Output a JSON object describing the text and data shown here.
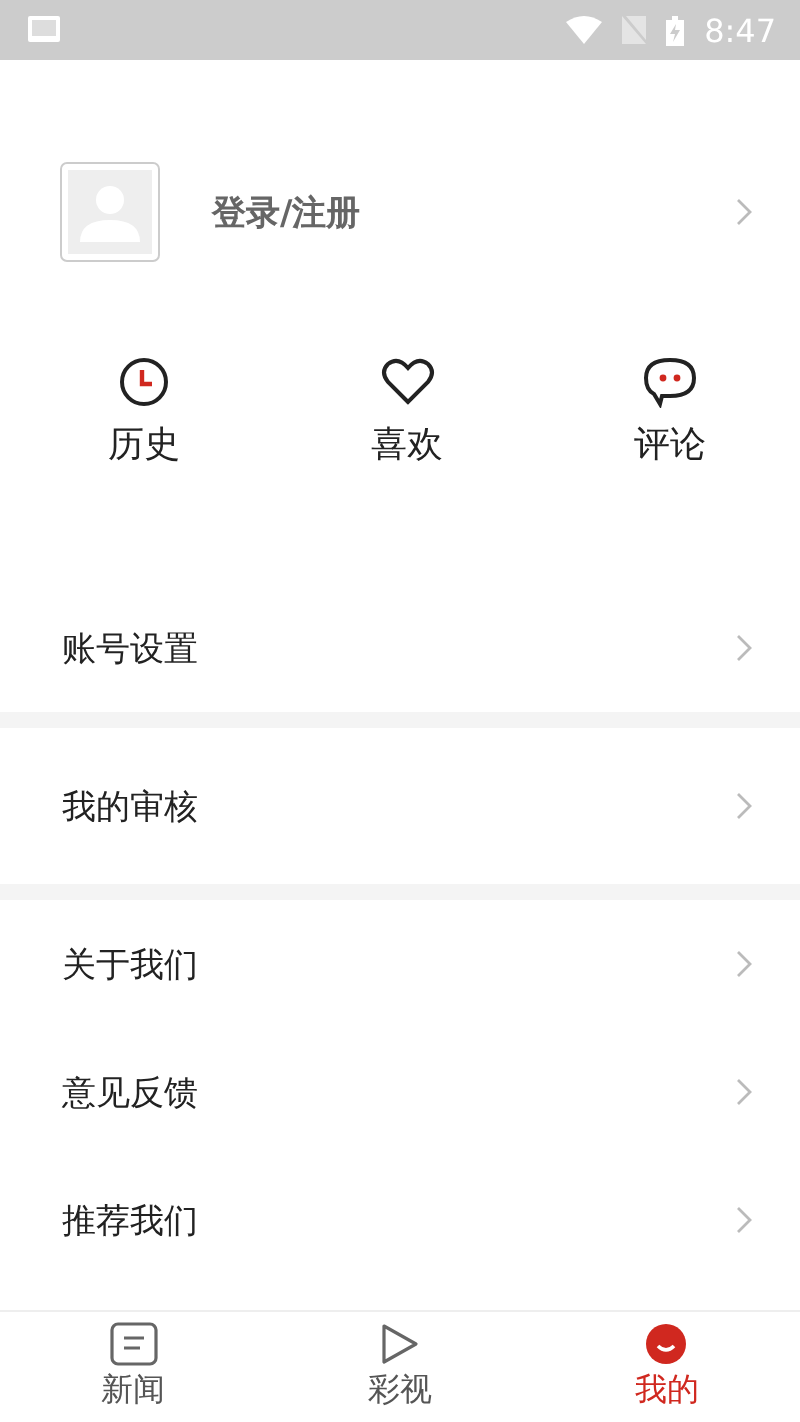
{
  "status_bar": {
    "time": "8:47"
  },
  "profile": {
    "login_label": "登录/注册"
  },
  "shortcuts": [
    {
      "label": "历史",
      "kind": "history"
    },
    {
      "label": "喜欢",
      "kind": "like"
    },
    {
      "label": "评论",
      "kind": "comment"
    }
  ],
  "menu_groups": [
    [
      {
        "label": "账号设置"
      }
    ],
    [
      {
        "label": "我的审核"
      }
    ],
    [
      {
        "label": "关于我们"
      },
      {
        "label": "意见反馈"
      },
      {
        "label": "推荐我们"
      }
    ]
  ],
  "tab_bar": [
    {
      "label": "新闻",
      "kind": "news",
      "selected": false
    },
    {
      "label": "彩视",
      "kind": "video",
      "selected": false
    },
    {
      "label": "我的",
      "kind": "me",
      "selected": true
    }
  ]
}
